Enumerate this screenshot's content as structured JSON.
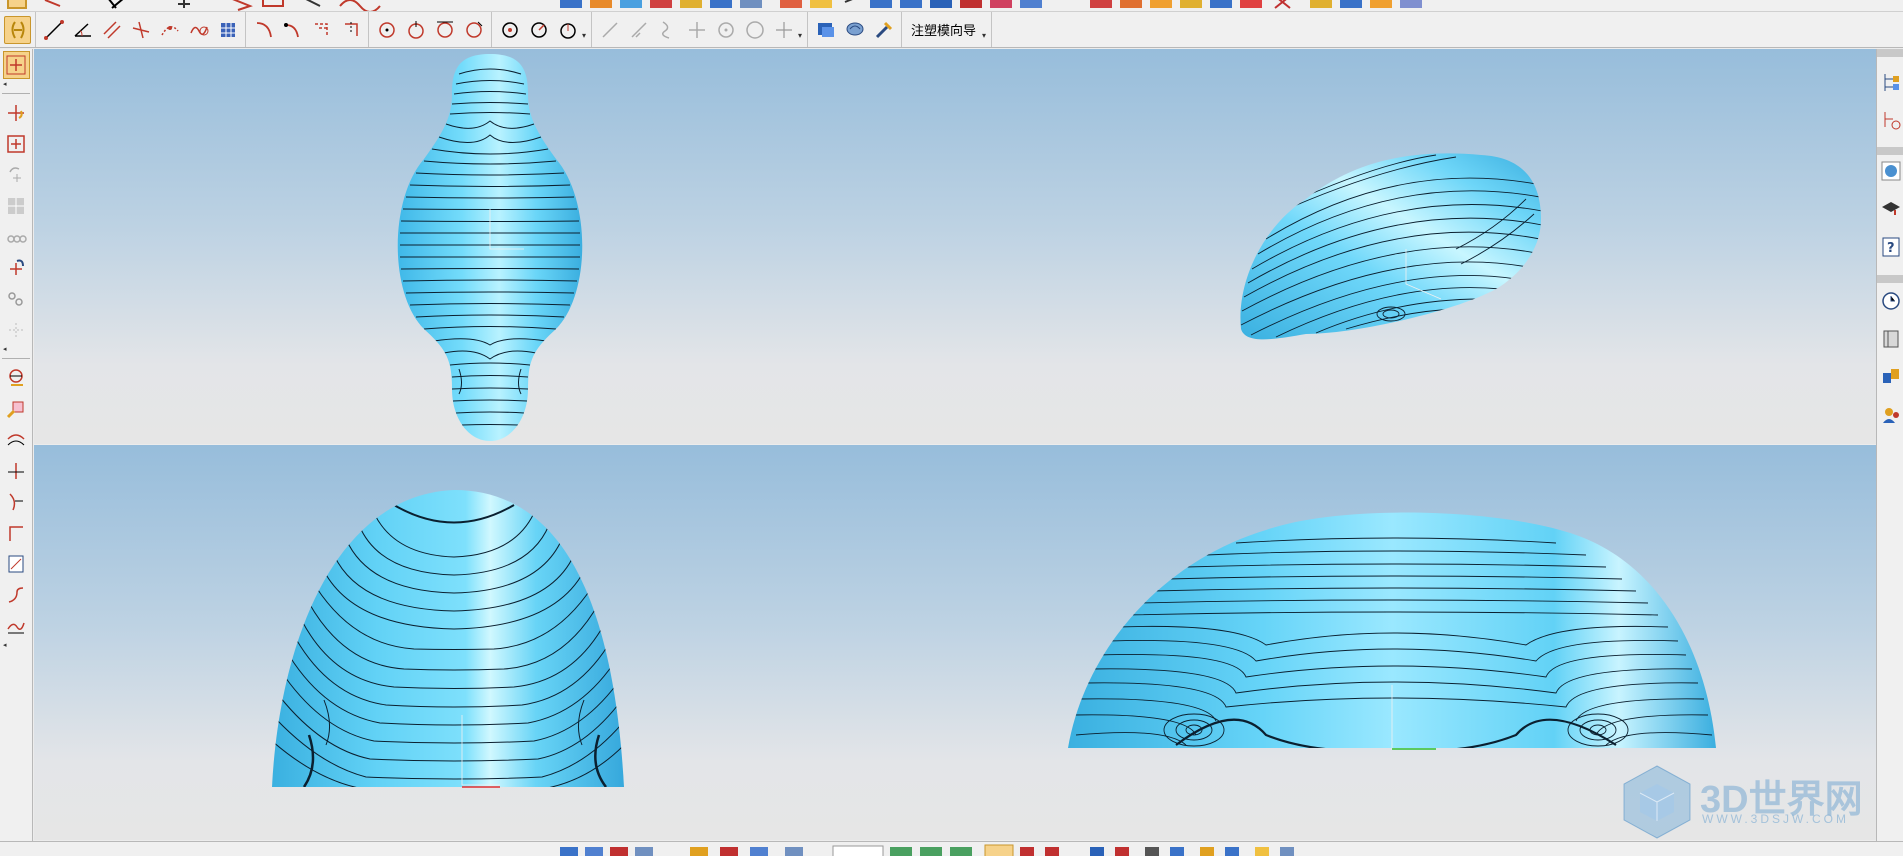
{
  "app": {
    "toolbar_text_button": "注塑模向导"
  },
  "watermark": {
    "title": "3D世界网",
    "url": "WWW.3DSJW.COM"
  },
  "colors": {
    "surface": "#5fd3f7",
    "surface_highlight": "#ffffff",
    "viewport_top": "#97bddb",
    "viewport_bottom": "#e6e6e6",
    "toolbar_bg": "#f0f0f0",
    "active_button": "#f6d28a"
  },
  "views": {
    "top_left": "top view",
    "top_right": "isometric view",
    "bottom_left": "front view",
    "bottom_right": "side view"
  },
  "icons": {
    "row2": [
      "snap-icon",
      "line-icon",
      "angle-icon",
      "parallel-line-icon",
      "cross-line-icon",
      "arc-point-icon",
      "spline-icon",
      "grid-icon",
      "fillet-icon",
      "curve-icon",
      "offset-icon",
      "trim-icon",
      "circle-icon",
      "circle-center-icon",
      "circle-tangent-icon",
      "circle-3pt-icon",
      "point-circle-icon",
      "arc-icon",
      "arc-angle-icon",
      "line-gray-icon",
      "slant-line-gray-icon",
      "curve-gray-icon",
      "plus-gray-icon",
      "circle-gray-icon",
      "circle-outline-gray-icon",
      "cross-gray-icon",
      "mold-wizard-icon",
      "mold-brain-icon",
      "mold-tools-icon"
    ],
    "left": [
      "point-cross-icon",
      "move-point-icon",
      "target-icon",
      "rotate-gray-icon",
      "grid-gray-icon",
      "chain-gray-icon",
      "rotate-point-icon",
      "chain-link-icon",
      "scatter-gray-icon",
      "measure-icon",
      "search-icon",
      "curve-offset-icon",
      "intersect-icon",
      "extend-icon",
      "corner-icon",
      "page-icon",
      "bridge-icon",
      "blend-icon"
    ],
    "right": [
      "tree-icon",
      "tree-node-icon",
      "globe-icon",
      "graduation-icon",
      "help-icon",
      "clock-icon",
      "book-icon",
      "assembly-icon",
      "user-icon"
    ]
  }
}
